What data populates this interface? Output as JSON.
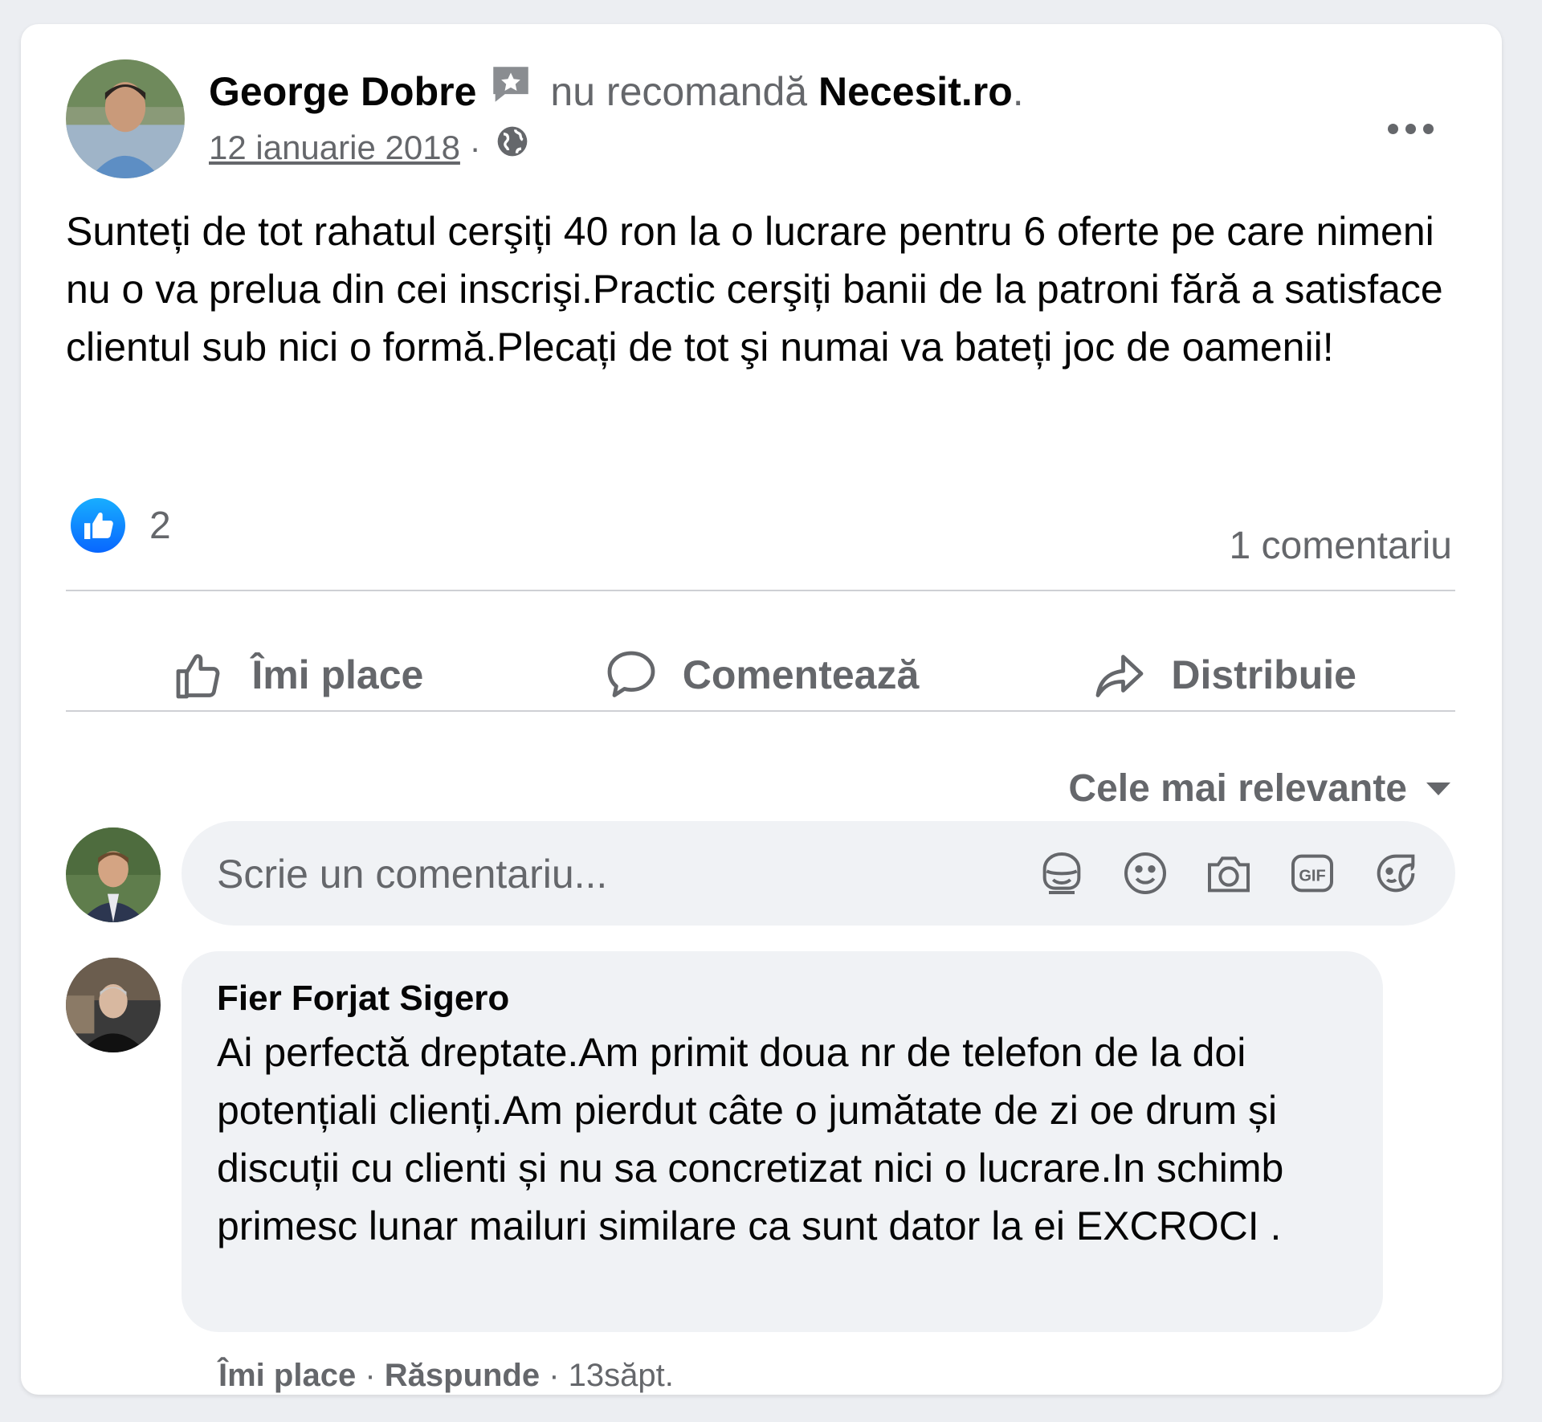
{
  "post": {
    "author": "George Dobre",
    "recommend_text": "nu recomandă",
    "page_name": "Necesit.ro",
    "period": ".",
    "date": "12 ianuarie 2018",
    "separator": " · ",
    "text": "Sunteți de tot rahatul cerşiți 40 ron la o lucrare pentru 6 oferte pe care nimeni nu o va prelua din cei inscrişi.Practic cerşiți banii de la patroni fără a satisface clientul sub nici o formă.Plecați de tot şi numai va bateți joc de oamenii!",
    "reaction_count": "2",
    "comment_count": "1 comentariu"
  },
  "actions": {
    "like": "Îmi place",
    "comment": "Comentează",
    "share": "Distribuie"
  },
  "sort": {
    "label": "Cele mai relevante"
  },
  "comment_input": {
    "placeholder": "Scrie un comentariu..."
  },
  "comment": {
    "author": "Fier Forjat Sigero",
    "text": "Ai perfectă dreptate.Am primit doua nr de telefon de la doi potențiali clienți.Am pierdut câte o jumătate de zi oe drum și discuții cu clienti și nu sa concretizat nici o lucrare.In schimb primesc lunar mailuri similare ca sunt dator la ei EXCROCI .",
    "like_label": "Îmi place",
    "reply_label": "Răspunde",
    "separator": " · ",
    "time": "13săpt."
  },
  "icons": {
    "recommend": "star-recommendation-icon",
    "audience": "globe-icon",
    "more": "more-options-icon",
    "like": "thumbs-up-icon",
    "comment": "speech-bubble-icon",
    "share": "share-arrow-icon",
    "sort": "caret-down-icon",
    "input": [
      "avatar-sticker-icon",
      "emoji-icon",
      "camera-icon",
      "gif-icon",
      "sticker-icon"
    ]
  },
  "colors": {
    "like_blue": "#1877f2",
    "secondary_text": "#65676b",
    "bubble_bg": "#f0f2f5"
  }
}
